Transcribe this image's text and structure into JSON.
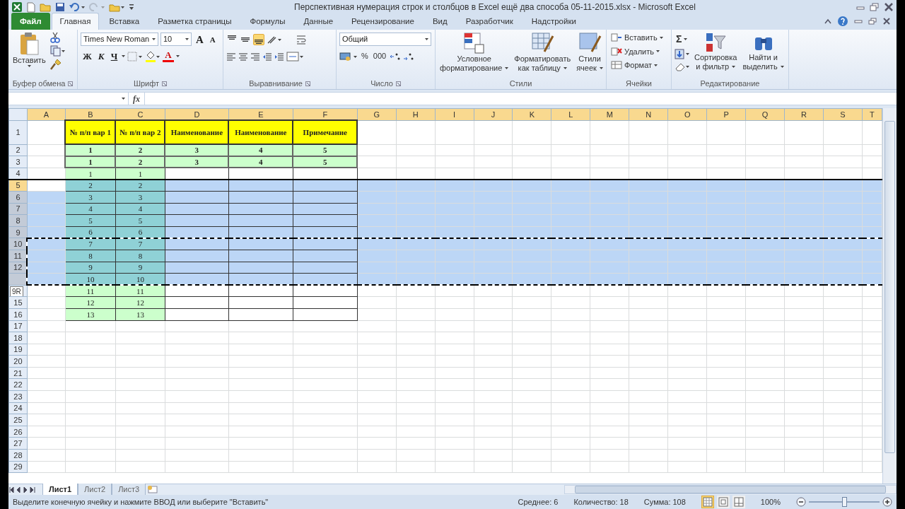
{
  "window": {
    "title": "Перспективная нумерация строк и столбцов в Excel ещё два способа 05-11-2015.xlsx  -  Microsoft Excel"
  },
  "ribbon_tabs": [
    {
      "label": "Файл",
      "kind": "file",
      "selected": false
    },
    {
      "label": "Главная",
      "kind": "tab",
      "selected": true
    },
    {
      "label": "Вставка",
      "kind": "tab",
      "selected": false
    },
    {
      "label": "Разметка страницы",
      "kind": "tab",
      "selected": false
    },
    {
      "label": "Формулы",
      "kind": "tab",
      "selected": false
    },
    {
      "label": "Данные",
      "kind": "tab",
      "selected": false
    },
    {
      "label": "Рецензирование",
      "kind": "tab",
      "selected": false
    },
    {
      "label": "Вид",
      "kind": "tab",
      "selected": false
    },
    {
      "label": "Разработчик",
      "kind": "tab",
      "selected": false
    },
    {
      "label": "Надстройки",
      "kind": "tab",
      "selected": false
    }
  ],
  "clipboard": {
    "paste": "Вставить",
    "label": "Буфер обмена"
  },
  "font": {
    "name": "Times New Roman",
    "size": "10",
    "grow": "A",
    "shrink": "A",
    "bold": "Ж",
    "italic": "К",
    "underline": "Ч",
    "font_color_button": "A",
    "label": "Шрифт"
  },
  "alignment": {
    "vertical": [
      {
        "selected": false
      },
      {
        "selected": false
      },
      {
        "selected": true
      }
    ],
    "label": "Выравнивание"
  },
  "number": {
    "format": "Общий",
    "percent": "%",
    "thousands": "000",
    "label": "Число"
  },
  "styles": {
    "buttons": [
      [
        "Условное",
        "форматирование"
      ],
      [
        "Форматировать",
        "как таблицу"
      ],
      [
        "Стили",
        "ячеек"
      ]
    ],
    "label": "Стили"
  },
  "cells": {
    "buttons": [
      "Вставить",
      "Удалить",
      "Формат"
    ],
    "label": "Ячейки"
  },
  "editing": {
    "sum": "Σ",
    "buttons": [
      [
        "Сортировка",
        "и фильтр"
      ],
      [
        "Найти и",
        "выделить"
      ]
    ],
    "label": "Редактирование"
  },
  "formula_bar": {
    "fx": "fx"
  },
  "sheet": {
    "columns": [
      {
        "label": "A",
        "selected": true
      },
      {
        "label": "B",
        "selected": true
      },
      {
        "label": "C",
        "selected": true
      },
      {
        "label": "D",
        "selected": true
      },
      {
        "label": "E",
        "selected": true
      },
      {
        "label": "F",
        "selected": true
      },
      {
        "label": "G",
        "selected": true
      },
      {
        "label": "H",
        "selected": true
      },
      {
        "label": "I",
        "selected": true
      },
      {
        "label": "J",
        "selected": true
      },
      {
        "label": "K",
        "selected": true
      },
      {
        "label": "L",
        "selected": true
      },
      {
        "label": "M",
        "selected": true
      },
      {
        "label": "N",
        "selected": true
      },
      {
        "label": "O",
        "selected": true
      },
      {
        "label": "P",
        "selected": true
      },
      {
        "label": "Q",
        "selected": true
      },
      {
        "label": "R",
        "selected": true
      },
      {
        "label": "S",
        "selected": true
      },
      {
        "label": "T",
        "selected": true
      }
    ],
    "rows": [
      {
        "header": "1",
        "selected": false,
        "copied": false,
        "cells": [
          "",
          {
            "kind": "heading",
            "text": "№ п/п вар 1"
          },
          {
            "kind": "heading",
            "text": "№ п/п вар 2"
          },
          {
            "kind": "heading",
            "text": "Наименование"
          },
          {
            "kind": "heading",
            "text": "Наименование"
          },
          {
            "kind": "heading",
            "text": "Примечание"
          }
        ]
      },
      {
        "header": "2",
        "selected": false,
        "copied": false,
        "cells": [
          "",
          {
            "kind": "total",
            "text": "1"
          },
          {
            "kind": "total",
            "text": "2"
          },
          {
            "kind": "total",
            "text": "3"
          },
          {
            "kind": "total",
            "text": "4"
          },
          {
            "kind": "total",
            "text": "5"
          }
        ]
      },
      {
        "header": "3",
        "selected": false,
        "copied": false,
        "cells": [
          "",
          {
            "kind": "total",
            "text": "1"
          },
          {
            "kind": "total",
            "text": "2"
          },
          {
            "kind": "total",
            "text": "3"
          },
          {
            "kind": "total",
            "text": "4"
          },
          {
            "kind": "total",
            "text": "5"
          }
        ]
      },
      {
        "header": "4",
        "selected": false,
        "copied": false,
        "cells": [
          "",
          {
            "kind": "index",
            "text": "1"
          },
          {
            "kind": "index",
            "text": "1"
          },
          {
            "kind": "blank"
          },
          {
            "kind": "blank"
          },
          {
            "kind": "blank"
          }
        ]
      },
      {
        "header": "5",
        "selected": true,
        "active": true,
        "copied": false,
        "cells": [
          {
            "kind": "active"
          },
          {
            "kind": "index",
            "text": "2"
          },
          {
            "kind": "index",
            "text": "2"
          },
          {
            "kind": "blank"
          },
          {
            "kind": "blank"
          },
          {
            "kind": "blank"
          }
        ]
      },
      {
        "header": "6",
        "selected": true,
        "copied": false,
        "cells": [
          "",
          {
            "kind": "index",
            "text": "3"
          },
          {
            "kind": "index",
            "text": "3"
          },
          {
            "kind": "blank"
          },
          {
            "kind": "blank"
          },
          {
            "kind": "blank"
          }
        ]
      },
      {
        "header": "7",
        "selected": true,
        "copied": false,
        "cells": [
          "",
          {
            "kind": "index",
            "text": "4"
          },
          {
            "kind": "index",
            "text": "4"
          },
          {
            "kind": "blank"
          },
          {
            "kind": "blank"
          },
          {
            "kind": "blank"
          }
        ]
      },
      {
        "header": "8",
        "selected": true,
        "copied": false,
        "cells": [
          "",
          {
            "kind": "index",
            "text": "5"
          },
          {
            "kind": "index",
            "text": "5"
          },
          {
            "kind": "blank"
          },
          {
            "kind": "blank"
          },
          {
            "kind": "blank"
          }
        ]
      },
      {
        "header": "9",
        "selected": true,
        "copied": false,
        "cells": [
          "",
          {
            "kind": "index",
            "text": "6"
          },
          {
            "kind": "index",
            "text": "6"
          },
          {
            "kind": "blank"
          },
          {
            "kind": "blank"
          },
          {
            "kind": "blank"
          }
        ]
      },
      {
        "header": "10",
        "selected": true,
        "copied": true,
        "cells": [
          "",
          {
            "kind": "index",
            "text": "7"
          },
          {
            "kind": "index",
            "text": "7"
          },
          {
            "kind": "blank"
          },
          {
            "kind": "blank"
          },
          {
            "kind": "blank"
          }
        ]
      },
      {
        "header": "11",
        "selected": true,
        "copied": true,
        "cells": [
          "",
          {
            "kind": "index",
            "text": "8"
          },
          {
            "kind": "index",
            "text": "8"
          },
          {
            "kind": "blank"
          },
          {
            "kind": "blank"
          },
          {
            "kind": "blank"
          }
        ]
      },
      {
        "header": "12",
        "selected": true,
        "copied": true,
        "cells": [
          "",
          {
            "kind": "index",
            "text": "9"
          },
          {
            "kind": "index",
            "text": "9"
          },
          {
            "kind": "blank"
          },
          {
            "kind": "blank"
          },
          {
            "kind": "blank"
          }
        ]
      },
      {
        "selected": true,
        "copied": true,
        "cells": [
          "",
          {
            "kind": "index",
            "text": "10"
          },
          {
            "kind": "index",
            "text": "10"
          },
          {
            "kind": "blank"
          },
          {
            "kind": "blank"
          },
          {
            "kind": "blank"
          }
        ]
      },
      {
        "selected": false,
        "copied": false,
        "tooltip": "9R",
        "cells": [
          "",
          {
            "kind": "index",
            "text": "11"
          },
          {
            "kind": "index",
            "text": "11"
          },
          {
            "kind": "blank"
          },
          {
            "kind": "blank"
          },
          {
            "kind": "blank"
          }
        ]
      },
      {
        "header": "15",
        "selected": false,
        "copied": false,
        "cells": [
          "",
          {
            "kind": "index",
            "text": "12"
          },
          {
            "kind": "index",
            "text": "12"
          },
          {
            "kind": "blank"
          },
          {
            "kind": "blank"
          },
          {
            "kind": "blank"
          }
        ]
      },
      {
        "header": "16",
        "selected": false,
        "copied": false,
        "cells": [
          "",
          {
            "kind": "index",
            "text": "13"
          },
          {
            "kind": "index",
            "text": "13"
          },
          {
            "kind": "blank"
          },
          {
            "kind": "blank"
          },
          {
            "kind": "blank"
          }
        ]
      },
      {
        "header": "17",
        "selected": false,
        "copied": false,
        "cells": []
      },
      {
        "header": "18",
        "selected": false,
        "copied": false,
        "cells": []
      },
      {
        "header": "19",
        "selected": false,
        "copied": false,
        "cells": []
      },
      {
        "header": "20",
        "selected": false,
        "copied": false,
        "cells": []
      },
      {
        "header": "21",
        "selected": false,
        "copied": false,
        "cells": []
      },
      {
        "header": "22",
        "selected": false,
        "copied": false,
        "cells": []
      },
      {
        "header": "23",
        "selected": false,
        "copied": false,
        "cells": []
      },
      {
        "header": "24",
        "selected": false,
        "copied": false,
        "cells": []
      },
      {
        "header": "25",
        "selected": false,
        "copied": false,
        "cells": []
      },
      {
        "header": "26",
        "selected": false,
        "copied": false,
        "cells": []
      },
      {
        "header": "27",
        "selected": false,
        "copied": false,
        "cells": []
      },
      {
        "header": "28",
        "selected": false,
        "copied": false,
        "cells": []
      },
      {
        "header": "29",
        "selected": false,
        "copied": false,
        "cells": []
      }
    ]
  },
  "sheet_tabs": [
    {
      "label": "Лист1",
      "selected": true
    },
    {
      "label": "Лист2",
      "selected": false
    },
    {
      "label": "Лист3",
      "selected": false
    }
  ],
  "status_bar": {
    "message": "Выделите конечную ячейку и нажмите ВВОД или выберите \"Вставить\"",
    "average": "Среднее: 6",
    "count": "Количество: 18",
    "sum": "Сумма: 108",
    "views": [
      {
        "selected": true
      },
      {
        "selected": false
      },
      {
        "selected": false
      }
    ],
    "zoom": "100%",
    "zoom_slider": {
      "level": 0.5
    }
  }
}
